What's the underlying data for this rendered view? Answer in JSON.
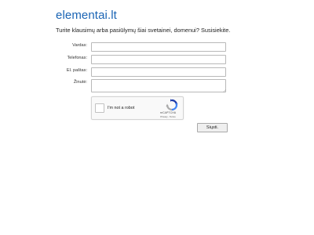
{
  "header": {
    "site_title": "elementai.lt",
    "intro_text": "Turite klausimų arba pasiūlymų šiai svetainei, domenui? Susisiekite."
  },
  "form": {
    "fields": [
      {
        "label": "Vardas:",
        "value": "",
        "type": "text"
      },
      {
        "label": "Telefonas:",
        "value": "",
        "type": "text"
      },
      {
        "label": "El. paštas:",
        "value": "",
        "type": "text"
      },
      {
        "label": "Žinutė:",
        "value": "",
        "type": "textarea"
      }
    ],
    "captcha": {
      "checkbox_label": "I'm not a robot",
      "brand": "reCAPTCHA",
      "links": "Privacy - Terms",
      "checked": false
    },
    "submit_label": "Siųsti."
  },
  "colors": {
    "title": "#1a64b4",
    "background": "#ffffff",
    "recaptcha_blue": "#1c3aa9",
    "recaptcha_lightblue": "#4285f4",
    "recaptcha_gray": "#ababab"
  }
}
